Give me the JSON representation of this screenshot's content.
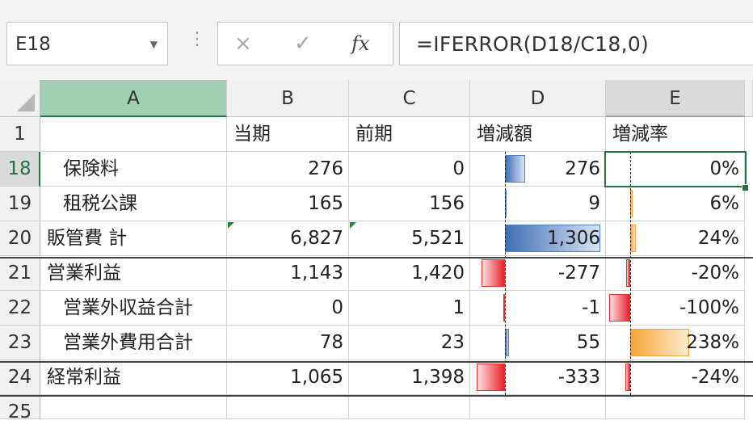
{
  "name_box": {
    "value": "E18",
    "dropdown_icon": "chevron-down-icon"
  },
  "formula_bar": {
    "cancel_icon": "×",
    "enter_icon": "✓",
    "fx_label": "fx",
    "formula": "=IFERROR(D18/C18,0)"
  },
  "columns": [
    "A",
    "B",
    "C",
    "D",
    "E"
  ],
  "header_row": {
    "row": "1",
    "a": "",
    "b": "当期",
    "c": "前期",
    "d": "増減額",
    "e": "増減率"
  },
  "rows": [
    {
      "row": "18",
      "a": "保険料",
      "b": "276",
      "c": "0",
      "d": "276",
      "e": "0%"
    },
    {
      "row": "19",
      "a": "租税公課",
      "b": "165",
      "c": "156",
      "d": "9",
      "e": "6%"
    },
    {
      "row": "20",
      "a": "販管費 計",
      "b": "6,827",
      "c": "5,521",
      "d": "1,306",
      "e": "24%"
    },
    {
      "row": "21",
      "a": "営業利益",
      "b": "1,143",
      "c": "1,420",
      "d": "-277",
      "e": "-20%"
    },
    {
      "row": "22",
      "a": "営業外収益合計",
      "b": "0",
      "c": "1",
      "d": "-1",
      "e": "-100%"
    },
    {
      "row": "23",
      "a": "営業外費用合計",
      "b": "78",
      "c": "23",
      "d": "55",
      "e": "238%"
    },
    {
      "row": "24",
      "a": "経常利益",
      "b": "1,065",
      "c": "1,398",
      "d": "-333",
      "e": "-24%"
    },
    {
      "row": "25",
      "a": "",
      "b": "",
      "c": "",
      "d": "",
      "e": ""
    }
  ],
  "data_bars": {
    "positive_color": "#4f7fc4",
    "negative_color": "#e03030",
    "rate_color": "#f2a23a",
    "d_values": [
      276,
      9,
      1306,
      -277,
      -1,
      55,
      -333
    ],
    "e_values": [
      0,
      0.06,
      0.24,
      -0.2,
      -1.0,
      2.38,
      -0.24
    ]
  },
  "colors": {
    "selection_green": "#217346",
    "header_bg": "#f0f0f0"
  }
}
